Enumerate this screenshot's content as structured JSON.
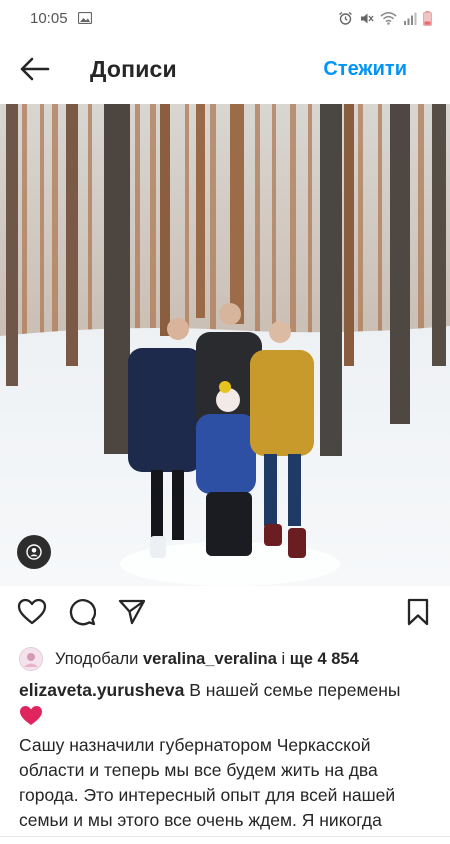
{
  "status_bar": {
    "time": "10:05",
    "icons": [
      "image-icon",
      "alarm-icon",
      "mute-icon",
      "wifi-icon",
      "signal-icon",
      "battery-icon"
    ]
  },
  "header": {
    "title": "Дописи",
    "follow_label": "Стежити",
    "icons": {
      "back": "arrow-left-icon"
    }
  },
  "post": {
    "photo_icons": {
      "tag": "person-tag-icon"
    },
    "actions": [
      "heart-icon",
      "comment-icon",
      "share-icon",
      "bookmark-icon"
    ],
    "likes": {
      "prefix": "Уподобали",
      "user": "veralina_veralina",
      "conjunction": "і",
      "more": "ще 4 854"
    },
    "caption": {
      "author": "elizaveta.yurusheva",
      "first_line": "В нашей семье перемены",
      "emoji": "❤️",
      "body": "Сашу назначили губернатором Черкасской области и теперь мы все будем жить на два города. Это интересный опыт для всей нашей семьи и мы этого все очень ждем. Я никогда"
    }
  },
  "colors": {
    "accent": "#0095f6",
    "text": "#262626",
    "heart": "#e0245e"
  }
}
